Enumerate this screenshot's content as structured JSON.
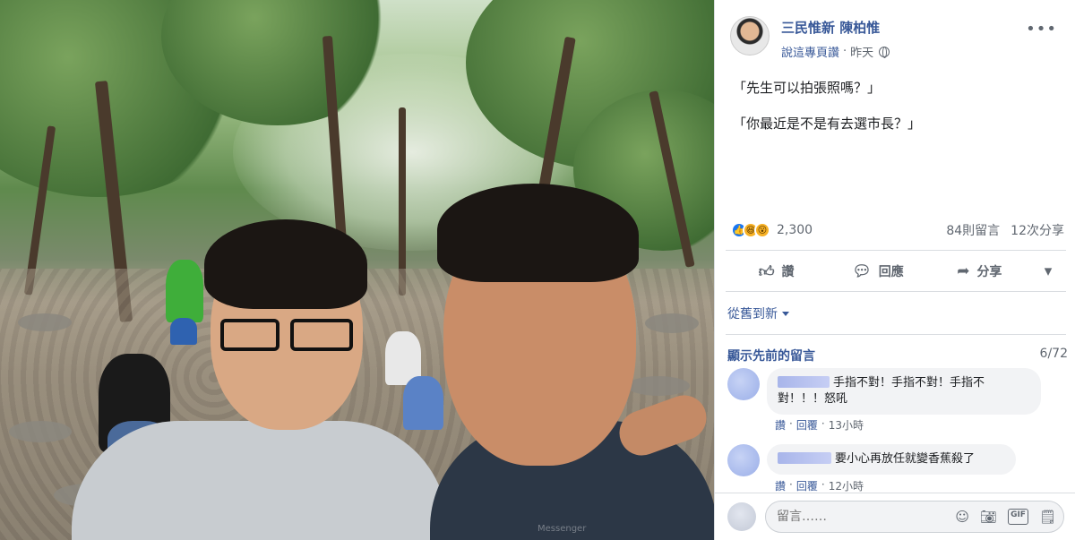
{
  "post": {
    "page_name": "三民惟新 陳柏惟",
    "like_page_link": "說這專頁讚",
    "separator": "·",
    "timestamp": "昨天",
    "visibility_icon": "globe-icon",
    "more_icon": "more-options-icon",
    "text_lines": [
      "「先生可以拍張照嗎？」",
      "「你最近是不是有去選市長？」"
    ]
  },
  "stats": {
    "reaction_icons": [
      "like-reaction-icon",
      "haha-reaction-icon",
      "wow-reaction-icon"
    ],
    "reaction_count": "2,300",
    "comments": "84則留言",
    "shares": "12次分享"
  },
  "actions": {
    "like": "讚",
    "comment": "回應",
    "share": "分享"
  },
  "comments_section": {
    "sort_label": "從舊到新",
    "view_previous": "顯示先前的留言",
    "count": "6/72",
    "comments": [
      {
        "text": "手指不對！手指不對！手指不對！！！怒吼",
        "like": "讚",
        "reply": "回覆",
        "dot": "·",
        "time": "13小時"
      },
      {
        "text": "要小心再放任就變香蕉殺了",
        "like": "讚",
        "reply": "回覆",
        "dot": "·",
        "time": "12小時"
      }
    ]
  },
  "composer": {
    "placeholder": "留言……"
  },
  "photo": {
    "watermark": "Messenger"
  },
  "colors": {
    "link": "#385898",
    "meta": "#606770",
    "like_blue": "#1877f2"
  }
}
